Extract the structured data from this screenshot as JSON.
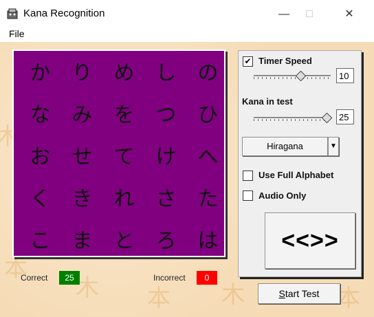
{
  "window": {
    "title": "Kana Recognition",
    "minimize_glyph": "—",
    "maximize_glyph": "□",
    "close_glyph": "✕"
  },
  "menu": {
    "file": "File"
  },
  "grid": {
    "rows": [
      [
        "か",
        "り",
        "め",
        "し",
        "の"
      ],
      [
        "な",
        "み",
        "を",
        "つ",
        "ひ"
      ],
      [
        "お",
        "せ",
        "て",
        "け",
        "へ"
      ],
      [
        "く",
        "き",
        "れ",
        "さ",
        "た"
      ],
      [
        "こ",
        "ま",
        "と",
        "ろ",
        "は"
      ]
    ]
  },
  "controls": {
    "timer_speed_checked": true,
    "timer_speed_label": "Timer Speed",
    "timer_speed_value": "10",
    "timer_speed_level": 0.62,
    "kana_in_test_label": "Kana in test",
    "kana_in_test_value": "25",
    "kana_in_test_level": 1.0,
    "alphabet_select": "Hiragana",
    "use_full_alphabet_label": "Use Full Alphabet",
    "use_full_alphabet_checked": false,
    "audio_only_label": "Audio Only",
    "audio_only_checked": false,
    "big_button_label": "<<>>"
  },
  "score": {
    "correct_label": "Correct",
    "correct_value": "25",
    "correct_color": "#008000",
    "incorrect_label": "Incorrect",
    "incorrect_value": "0",
    "incorrect_color": "#ff0000"
  },
  "start_button": {
    "label": "Start Test",
    "mnemonic": "S",
    "rest": "tart Test"
  }
}
